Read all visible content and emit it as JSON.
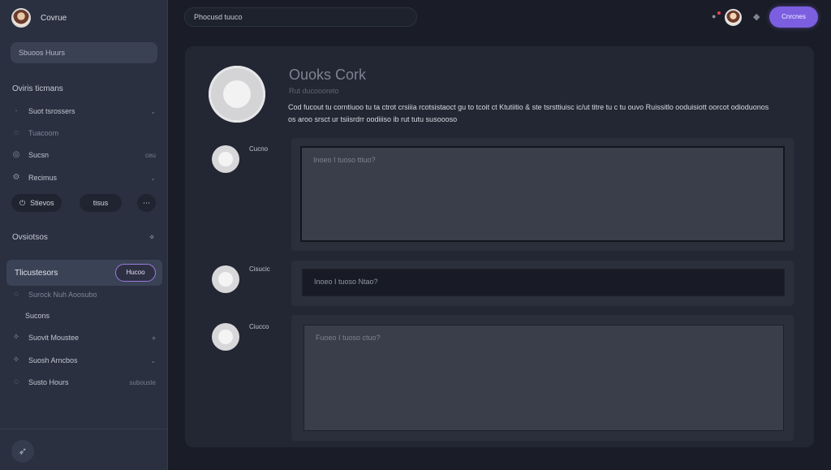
{
  "sidebar": {
    "brand": "Covrue",
    "search_placeholder": "Sbuoos Huurs",
    "section_1": "Oviris ticmans",
    "items": [
      {
        "label": "Suot tsrossers",
        "meta": "⌄"
      },
      {
        "label": "Tuacoom",
        "meta": ""
      },
      {
        "label": "Sucsn",
        "meta": "ceu"
      },
      {
        "label": "Recimus",
        "meta": "⌄"
      }
    ],
    "pills": [
      "Stievos",
      "tisus",
      "⋯"
    ],
    "section_2": "Ovsiotsos",
    "section_2_meta": "⋄",
    "active": {
      "label": "Tlicustesors",
      "badge": "Hucoo"
    },
    "subitems": [
      {
        "label": "Surock Nuh Aoosubo",
        "meta": ""
      },
      {
        "label": "Sucons",
        "meta": ""
      },
      {
        "label": "Suovit Moustee",
        "meta": "⋄"
      },
      {
        "label": "Suosh Arncbos",
        "meta": "⌄"
      },
      {
        "label": "Susto Hours",
        "meta": "subouste"
      }
    ]
  },
  "topbar": {
    "search_placeholder": "Phocusd tuuco",
    "cta_label": "Cnrcnes"
  },
  "hero": {
    "title": "Ouoks Cork",
    "subtitle": "Rut ducoooreto",
    "description": "Cod fucout tu corntiuoo tu ta ctrot crsiiia rcotsistaoct gu to tcoit ct Ktutiitio & ste tsrsttiuisc ic/ut titre tu c tu ouvo Ruissitlo ooduisiott oorcot odioduonos os aroo srsct ur tsiisrdrr oodiiiso ib rut tutu susoooso"
  },
  "questions": [
    {
      "label": "Cucno",
      "placeholder": "Inoeo I tuoso ttiuo?"
    },
    {
      "label": "Cisucic",
      "placeholder": "Inoeo I tuoso Ntao?"
    },
    {
      "label": "Ciucco",
      "placeholder": "Fuoeo I tuoso ctuo?"
    }
  ]
}
